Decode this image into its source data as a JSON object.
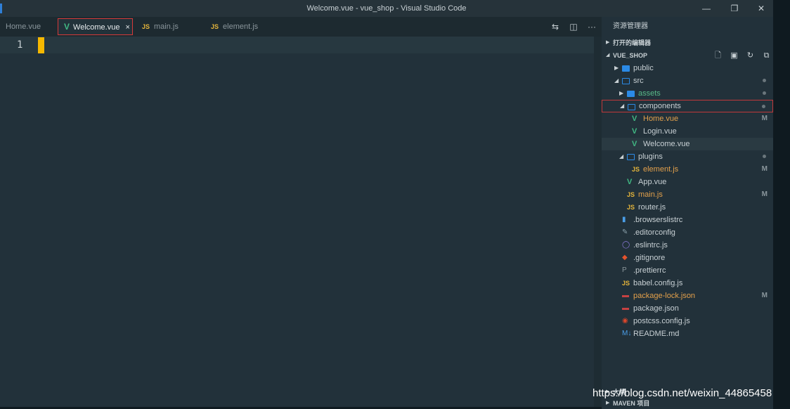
{
  "window": {
    "title": "Welcome.vue - vue_shop - Visual Studio Code",
    "controls": {
      "minimize": "—",
      "maximize": "❐",
      "close": "✕"
    }
  },
  "tabs": [
    {
      "label": "Home.vue",
      "icon": "vue-icon",
      "active": false
    },
    {
      "label": "Welcome.vue",
      "icon": "vue-icon",
      "active": true,
      "close": "×"
    },
    {
      "label": "main.js",
      "icon": "js-icon",
      "active": false
    },
    {
      "label": "element.js",
      "icon": "js-icon",
      "active": false
    }
  ],
  "tab_actions": {
    "compare": "⇆",
    "split": "◫",
    "more": "···"
  },
  "editor": {
    "line_numbers": [
      "1"
    ]
  },
  "sidebar": {
    "header": "资源管理器",
    "open_editors": "打开的编辑器",
    "project": "VUE_SHOP",
    "tools": {
      "new_file": "🗋",
      "new_folder": "▣",
      "refresh": "↻",
      "collapse": "⧉"
    },
    "tree": [
      {
        "label": "public",
        "depth": 0,
        "type": "folder",
        "expanded": false,
        "twisty": "▶"
      },
      {
        "label": "src",
        "depth": 0,
        "type": "folder",
        "expanded": true,
        "twisty": "◢",
        "dot": true
      },
      {
        "label": "assets",
        "depth": 1,
        "type": "folder",
        "expanded": false,
        "twisty": "▶",
        "dot": true,
        "color": "green"
      },
      {
        "label": "components",
        "depth": 1,
        "type": "folder",
        "expanded": true,
        "twisty": "◢",
        "dot": true,
        "selected": true
      },
      {
        "label": "Home.vue",
        "depth": 2,
        "type": "vue",
        "badge": "M",
        "color": "orange"
      },
      {
        "label": "Login.vue",
        "depth": 2,
        "type": "vue"
      },
      {
        "label": "Welcome.vue",
        "depth": 2,
        "type": "vue",
        "hover": true
      },
      {
        "label": "plugins",
        "depth": 1,
        "type": "folder",
        "expanded": true,
        "twisty": "◢",
        "dot": true
      },
      {
        "label": "element.js",
        "depth": 2,
        "type": "js",
        "badge": "M",
        "color": "orange"
      },
      {
        "label": "App.vue",
        "depth": 1,
        "type": "vue"
      },
      {
        "label": "main.js",
        "depth": 1,
        "type": "js",
        "badge": "M",
        "color": "orange"
      },
      {
        "label": "router.js",
        "depth": 1,
        "type": "js"
      },
      {
        "label": ".browserslistrc",
        "depth": 0,
        "type": "file",
        "icon": "file-icon"
      },
      {
        "label": ".editorconfig",
        "depth": 0,
        "type": "file",
        "icon": "editorconfig-icon"
      },
      {
        "label": ".eslintrc.js",
        "depth": 0,
        "type": "file",
        "icon": "eslint-icon"
      },
      {
        "label": ".gitignore",
        "depth": 0,
        "type": "file",
        "icon": "git-icon"
      },
      {
        "label": ".prettierrc",
        "depth": 0,
        "type": "file",
        "icon": "prettier-icon"
      },
      {
        "label": "babel.config.js",
        "depth": 0,
        "type": "js"
      },
      {
        "label": "package-lock.json",
        "depth": 0,
        "type": "file",
        "icon": "npm-icon",
        "badge": "M",
        "color": "orange"
      },
      {
        "label": "package.json",
        "depth": 0,
        "type": "file",
        "icon": "npm-icon"
      },
      {
        "label": "postcss.config.js",
        "depth": 0,
        "type": "file",
        "icon": "postcss-icon"
      },
      {
        "label": "README.md",
        "depth": 0,
        "type": "file",
        "icon": "markdown-icon"
      }
    ],
    "bottom": {
      "outline": "大纲",
      "maven": "MAVEN 项目"
    }
  },
  "watermark": "https://blog.csdn.net/weixin_44865458"
}
